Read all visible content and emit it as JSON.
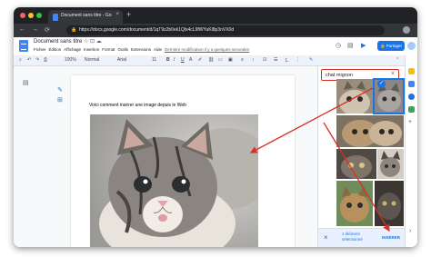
{
  "browser": {
    "tab_title": "Document sans titre - Google",
    "tab_close": "×",
    "new_tab": "+",
    "url": "https://docs.google.com/document/d/1qT9z2b0ek1Qlx4cL9fWYuKl8p3nVX0d",
    "nav": {
      "back": "←",
      "forward": "→",
      "reload": "⟳",
      "lock": "🔒"
    },
    "colors": {
      "close": "#ff5f57",
      "minimize": "#febc2e",
      "maximize": "#28c840",
      "frame": "#202124"
    }
  },
  "docs": {
    "title": "Document sans titre",
    "title_icons": "☆ ⊡ ☁",
    "menus": [
      "Fichier",
      "Édition",
      "Affichage",
      "Insertion",
      "Format",
      "Outils",
      "Extensions",
      "Aide"
    ],
    "last_edit": "Dernière modification il y a quelques secondes",
    "share_label": "🔒 Partager",
    "accent": "#1a73e8"
  },
  "toolbar": {
    "undo": "↶",
    "redo": "↷",
    "print": "⎙",
    "zoom": "100%",
    "style": "Normal",
    "font": "Arial",
    "size": "11",
    "bold": "B",
    "italic": "I",
    "underline": "U",
    "text_color": "A",
    "pen": "✎"
  },
  "document": {
    "text": "Voici comment insérer une image depuis le Web"
  },
  "image_search": {
    "query": "chat mignon",
    "clear": "×",
    "selected_mark": "✓",
    "selected_count": "1 élément sélectionné",
    "insert_label": "INSÉRER",
    "close": "×"
  }
}
